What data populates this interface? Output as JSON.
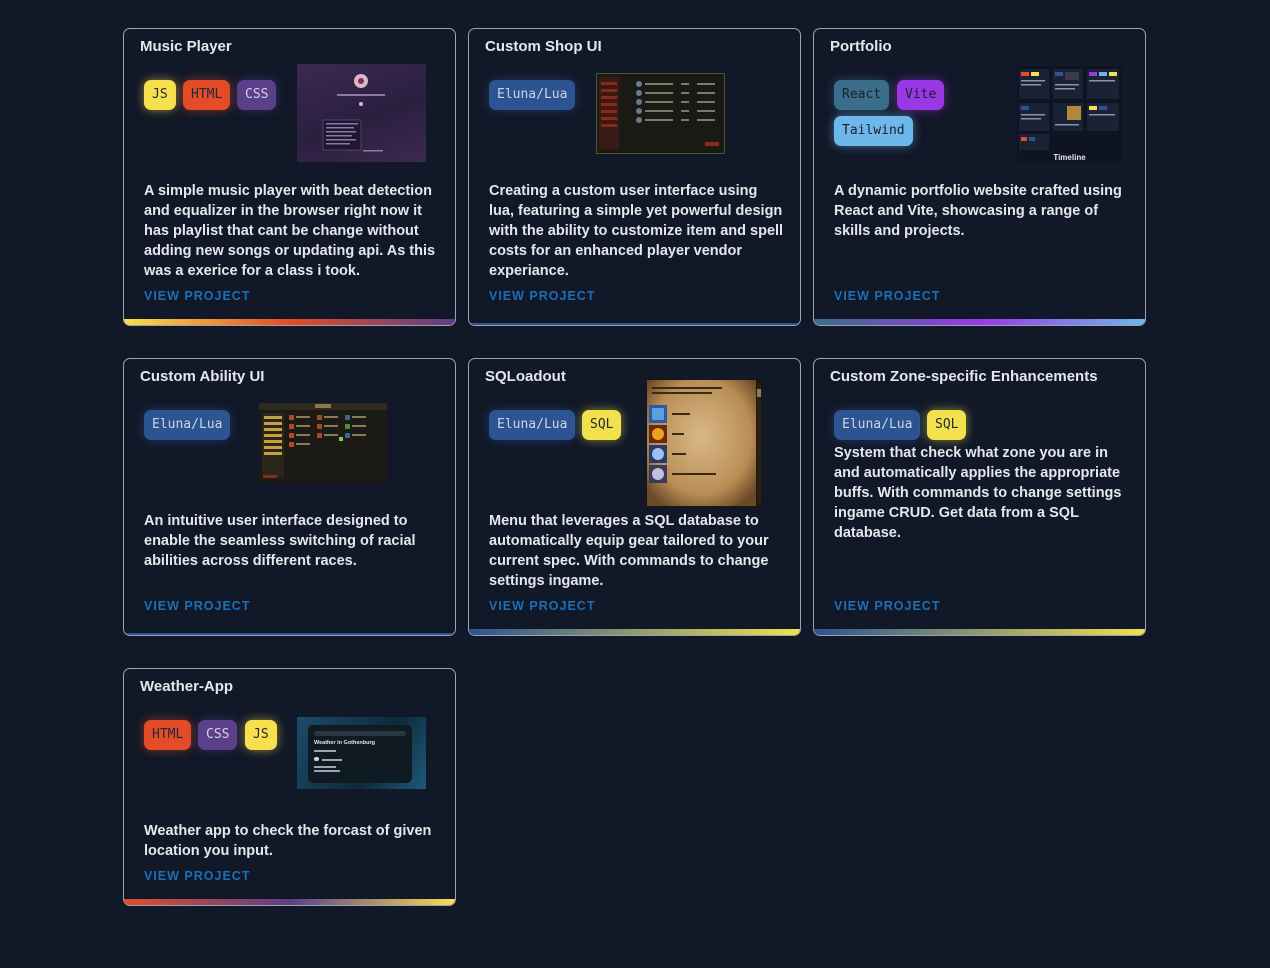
{
  "view_label": "VIEW PROJECT",
  "projects": [
    {
      "title": "Music Player",
      "tags": [
        "JS",
        "HTML",
        "CSS"
      ],
      "description": "A simple music player with beat detection and equalizer in the browser right now it has playlist that cant be change without adding new songs or updating api. As this was a exerice for a class i took."
    },
    {
      "title": "Custom Shop UI",
      "tags": [
        "Eluna/Lua"
      ],
      "description": "Creating a custom user interface using lua, featuring a simple yet powerful design with the ability to customize item and spell costs for an enhanced player vendor experiance."
    },
    {
      "title": "Portfolio",
      "tags": [
        "React",
        "Vite",
        "Tailwind"
      ],
      "description": "A dynamic portfolio website crafted using React and Vite, showcasing a range of skills and projects.",
      "thumb_caption": "Timeline"
    },
    {
      "title": "Custom Ability UI",
      "tags": [
        "Eluna/Lua"
      ],
      "description": "An intuitive user interface designed to enable the seamless switching of racial abilities across different races."
    },
    {
      "title": "SQLoadout",
      "tags": [
        "Eluna/Lua",
        "SQL"
      ],
      "description": "Menu that leverages a SQL database to automatically equip gear tailored to your current spec. With commands to change settings ingame."
    },
    {
      "title": "Custom Zone-specific Enhancements",
      "tags": [
        "Eluna/Lua",
        "SQL"
      ],
      "description": "System that check what zone you are in and automatically applies the appropriate buffs. With commands to change settings ingame CRUD. Get data from a SQL database."
    },
    {
      "title": "Weather-App",
      "tags": [
        "HTML",
        "CSS",
        "JS"
      ],
      "description": "Weather app to check the forcast of given location you input.",
      "thumb_title": "Weather in Gothenburg"
    }
  ],
  "colors": {
    "background": "#111827",
    "card_border": "#9ca3af",
    "link": "#1d6fb8",
    "js": "#f7df4e",
    "html": "#e34c26",
    "css": "#5b3f8a",
    "lua": "#2c5392",
    "sql": "#f2e14c",
    "react": "#3a6e8a",
    "vite": "#9b38e6",
    "tailwind": "#6db7ea"
  }
}
